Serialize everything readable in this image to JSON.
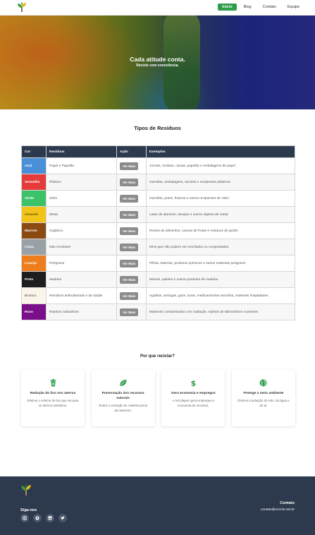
{
  "nav": {
    "items": [
      {
        "label": "Início",
        "active": true
      },
      {
        "label": "Blog",
        "active": false
      },
      {
        "label": "Contato",
        "active": false
      },
      {
        "label": "Equipe",
        "active": false
      }
    ]
  },
  "hero": {
    "title": "Cada atitude conta.",
    "subtitle": "Recicle com consciência."
  },
  "waste_section": {
    "title": "Tipos de Resíduos",
    "headers": [
      "Cor",
      "Resíduos",
      "Ação",
      "Exemplos"
    ],
    "button_label": "Ver Mais",
    "rows": [
      {
        "color": "Azul",
        "hex": "#4a90d9",
        "text": "#ffffff",
        "waste": "Papel e Papelão",
        "examples": "Jornais, revistas, caixas, papelão e embalagens de papel"
      },
      {
        "color": "Vermelho",
        "hex": "#e53b3b",
        "text": "#ffffff",
        "waste": "Plástico",
        "examples": "Garrafas, embalagens, sacolas e recipientes plásticos"
      },
      {
        "color": "Verde",
        "hex": "#3cc36a",
        "text": "#ffffff",
        "waste": "Vidro",
        "examples": "Garrafas, potes, frascos e outros recipientes de vidro"
      },
      {
        "color": "Amarelo",
        "hex": "#f2c318",
        "text": "#6a5300",
        "waste": "Metal",
        "examples": "Latas de alumínio, tampas e outros objetos de metal"
      },
      {
        "color": "Marrom",
        "hex": "#8a4a12",
        "text": "#ffffff",
        "waste": "Orgânico",
        "examples": "Restos de alimentos, cascas de frutas e resíduos de jardim"
      },
      {
        "color": "Cinza",
        "hex": "#9aa1a6",
        "text": "#ffffff",
        "waste": "Não reciclável",
        "examples": "Itens que não podem ser reciclados ou compostados"
      },
      {
        "color": "Laranja",
        "hex": "#ee7d1e",
        "text": "#ffffff",
        "waste": "Perigosos",
        "examples": "Pilhas, baterias, produtos químicos e outros materiais perigosos"
      },
      {
        "color": "Preto",
        "hex": "#1e1e1e",
        "text": "#ffffff",
        "waste": "Madeira",
        "examples": "Móveis, paletes e outros produtos de madeira"
      },
      {
        "color": "Branco",
        "hex": "#fbf4ea",
        "text": "#777777",
        "waste": "Resíduos ambulatoriais e de saúde",
        "examples": "Agulhas, seringas, gaze, luvas, medicamentos vencidos, materiais hospitalares"
      },
      {
        "color": "Roxo",
        "hex": "#7a0f8a",
        "text": "#ffffff",
        "waste": "Rejeitos radioativos",
        "examples": "Materiais contaminados com radiação, rejeitos de laboratórios nucleares"
      }
    ]
  },
  "why_section": {
    "title": "Por que reciclar?",
    "cards": [
      {
        "icon": "trash-icon",
        "title": "Redução do lixo nos aterros",
        "desc": "Diminui o volume de lixo que vai para os aterros sanitários."
      },
      {
        "icon": "leaf-icon",
        "title": "Preservação dos recursos naturais",
        "desc": "Reduz a extração de matéria-prima da natureza."
      },
      {
        "icon": "dollar-icon",
        "title": "Gera economia e empregos",
        "desc": "A reciclagem gera empregos e economia de recursos."
      },
      {
        "icon": "globe-icon",
        "title": "Protege o meio ambiente",
        "desc": "Diminui a poluição do solo, da água e do ar."
      }
    ]
  },
  "footer": {
    "follow_label": "Siga-nos",
    "socials": [
      "instagram-icon",
      "github-icon",
      "linkedin-icon",
      "twitter-icon"
    ],
    "contact_title": "Contato",
    "contact_email": "contato@recicle.net.br"
  },
  "colors": {
    "accent": "#2e9e4a",
    "dark": "#2d3a4e",
    "button": "#8c8c8c"
  }
}
